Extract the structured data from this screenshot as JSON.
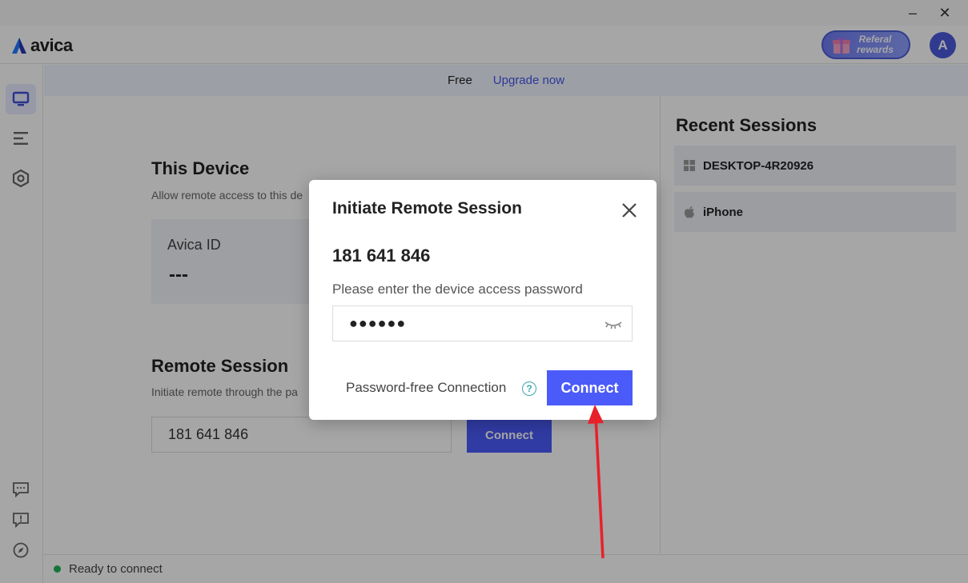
{
  "window": {
    "minimize_glyph": "–",
    "close_glyph": "✕"
  },
  "header": {
    "brand": "avica",
    "referral_line1": "Referal",
    "referral_line2": "rewards",
    "avatar_initial": "A"
  },
  "banner": {
    "plan": "Free",
    "upgrade": "Upgrade now"
  },
  "this_device": {
    "title": "This Device",
    "subtitle": "Allow remote access to this de",
    "id_label": "Avica ID",
    "id_value": "---"
  },
  "remote_session": {
    "title": "Remote Session",
    "subtitle": "Initiate remote through the pa",
    "input_value": "181 641 846",
    "connect_label": "Connect"
  },
  "recent": {
    "title": "Recent Sessions",
    "items": [
      {
        "label": "DESKTOP-4R20926",
        "icon": "windows-icon"
      },
      {
        "label": "iPhone",
        "icon": "apple-icon"
      }
    ]
  },
  "status": {
    "text": "Ready to connect",
    "color": "#1fb556"
  },
  "modal": {
    "title": "Initiate Remote Session",
    "device_id": "181 641 846",
    "prompt": "Please enter the device access password",
    "password_masked": "●●●●●●",
    "password_free_label": "Password-free Connection",
    "help_glyph": "?",
    "connect_label": "Connect"
  },
  "colors": {
    "accent": "#4b5bfa",
    "annotation_arrow": "#e8202a"
  }
}
